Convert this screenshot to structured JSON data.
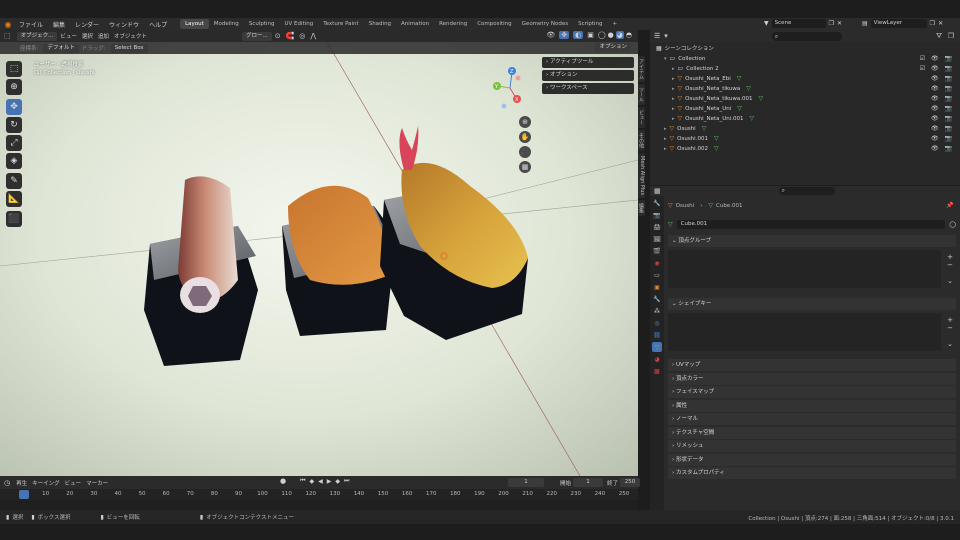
{
  "topbar": {
    "menus": [
      "ファイル",
      "編集",
      "レンダー",
      "ウィンドウ",
      "ヘルプ"
    ],
    "workspaces": [
      "Layout",
      "Modeling",
      "Sculpting",
      "UV Editing",
      "Texture Paint",
      "Shading",
      "Animation",
      "Rendering",
      "Compositing",
      "Geometry Nodes",
      "Scripting"
    ],
    "active_workspace": "Layout",
    "add_tab": "+",
    "scene": "Scene",
    "view_layer": "ViewLayer"
  },
  "viewport": {
    "mode": "オブジェク...",
    "menus": [
      "ビュー",
      "選択",
      "追加",
      "オブジェクト"
    ],
    "transform_orientation": "グロー...",
    "sub": {
      "orientation_label": "座標系:",
      "orientation": "デフォルト",
      "drag_label": "ドラッグ:",
      "drag_value": "Select Box",
      "options": "オプション"
    },
    "overlay_title": "ユーザー・透視投影",
    "overlay_subtitle": "(1) Collection | Osushi",
    "n_panel": [
      "アクティブツール",
      "オプション",
      "ワークスペース"
    ],
    "side_tabs": [
      "アイテム",
      "ツール",
      "ビュー",
      "その他",
      "Mesh Align Plus",
      "編集"
    ],
    "gizmo": {
      "x": "X",
      "y": "Y",
      "z": "Z"
    }
  },
  "timeline": {
    "menus": [
      "再生",
      "キーイング",
      "ビュー",
      "マーカー"
    ],
    "current_frame": "1",
    "start_label": "開始",
    "start": "1",
    "end_label": "終了",
    "end": "250",
    "ticks": [
      "1",
      "10",
      "20",
      "30",
      "40",
      "50",
      "60",
      "70",
      "80",
      "90",
      "100",
      "110",
      "120",
      "130",
      "140",
      "150",
      "160",
      "170",
      "180",
      "190",
      "200",
      "210",
      "220",
      "230",
      "240",
      "250"
    ],
    "current_frame_value": 1,
    "frame_range": [
      1,
      250
    ]
  },
  "statusbar": {
    "items": [
      "選択",
      "ボックス選択",
      "ビューを回転",
      "オブジェクトコンテクストメニュー"
    ],
    "stats": "Collection | Osushi | 頂点:274 | 面:258 | 三角面:514 | オブジェクト:0/8 | 3.0.1"
  },
  "outliner": {
    "root": "シーンコレクション",
    "rows": [
      {
        "name": "Collection",
        "type": "collection",
        "indent": 1
      },
      {
        "name": "Collection 2",
        "type": "collection",
        "indent": 2
      },
      {
        "name": "Osushi_Neta_Ebi",
        "type": "mesh",
        "indent": 2
      },
      {
        "name": "Osushi_Neta_tikuwa",
        "type": "mesh",
        "indent": 2
      },
      {
        "name": "Osushi_Neta_tikuwa.001",
        "type": "mesh",
        "indent": 2
      },
      {
        "name": "Osushi_Neta_Uni",
        "type": "mesh",
        "indent": 2
      },
      {
        "name": "Osushi_Neta_Uni.001",
        "type": "mesh",
        "indent": 2
      },
      {
        "name": "Osushi",
        "type": "mesh",
        "indent": 1
      },
      {
        "name": "Osushi.001",
        "type": "mesh",
        "indent": 1
      },
      {
        "name": "Osushi.002",
        "type": "mesh",
        "indent": 1
      }
    ]
  },
  "properties": {
    "breadcrumb_object": "Osushi",
    "breadcrumb_data": "Cube.001",
    "mesh_name": "Cube.001",
    "panels": [
      "頂点グループ",
      "シェイプキー",
      "UVマップ",
      "頂点カラー",
      "フェイスマップ",
      "属性",
      "ノーマル",
      "テクスチャ空間",
      "リメッシュ",
      "形状データ",
      "カスタムプロパティ"
    ]
  },
  "colors": {
    "accent": "#4772b3",
    "mesh_icon": "#e58a2e",
    "data_icon": "#5fc46a"
  }
}
